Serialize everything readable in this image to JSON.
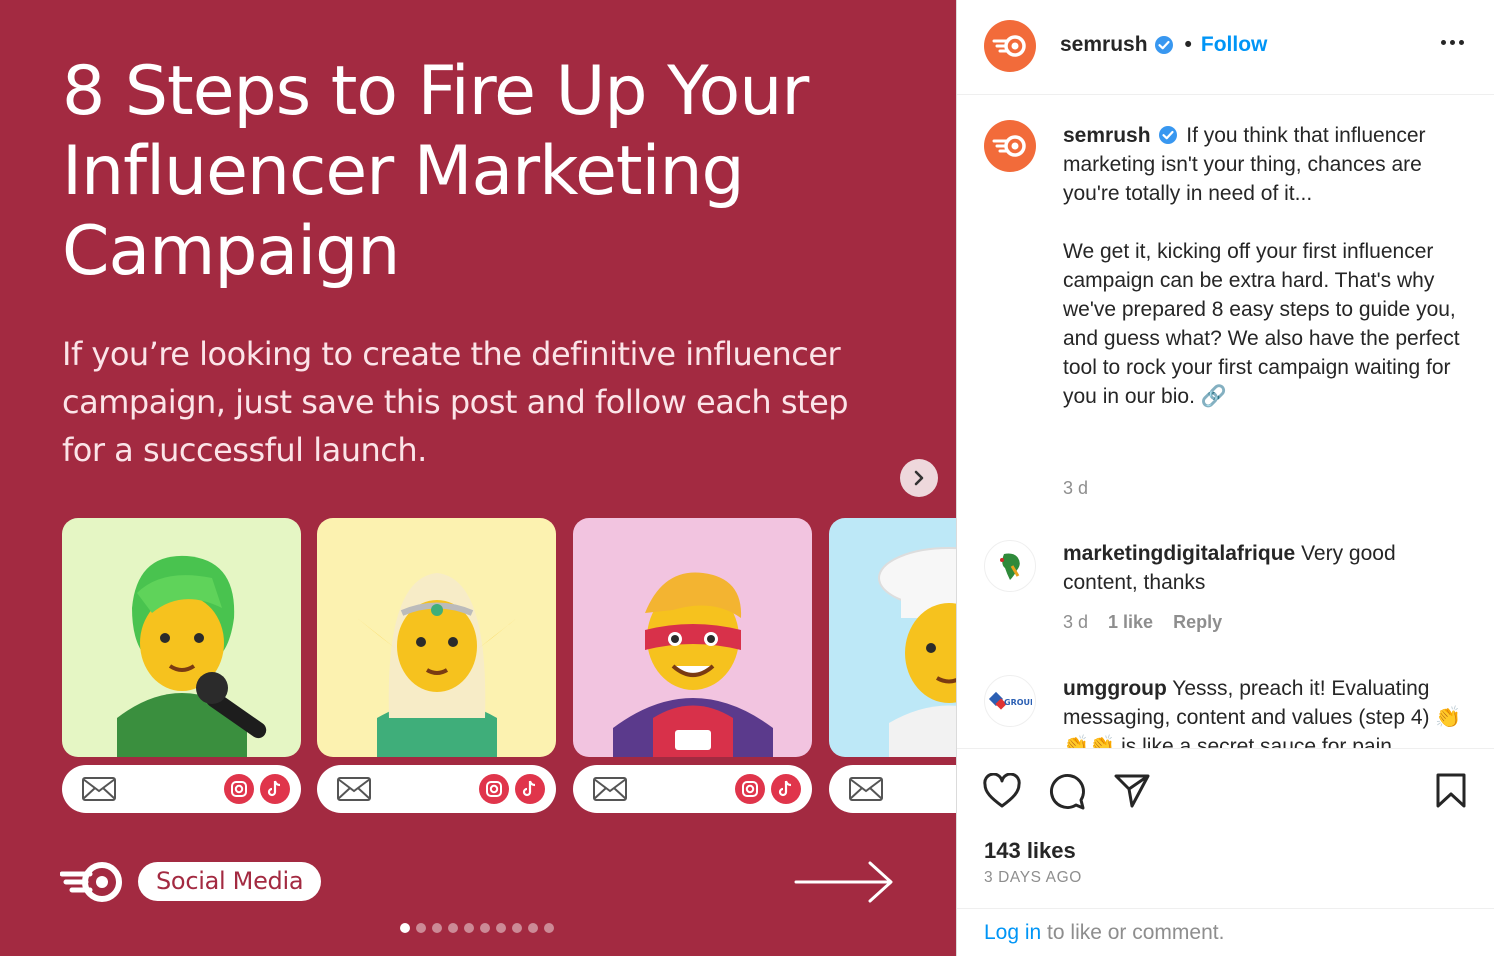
{
  "colors": {
    "post_bg": "#a32a41",
    "brand_orange": "#f26b3a",
    "link_blue": "#0095f6",
    "verified_blue": "#3897f0",
    "social_red": "#e0354b"
  },
  "post": {
    "title": "8 Steps to Fire Up Your Influencer Marketing Campaign",
    "subtitle": "If you’re looking to create the definitive influencer campaign, just save this post and follow each step for a successful launch.",
    "tag": "Social Media",
    "carousel_total": 10,
    "carousel_index": 1,
    "cards": [
      {
        "name": "singer",
        "bg": "#e5f6c4",
        "icons": [
          "mail-icon",
          "instagram-icon",
          "tiktok-icon"
        ]
      },
      {
        "name": "elf",
        "bg": "#fcf2b0",
        "icons": [
          "mail-icon",
          "instagram-icon",
          "tiktok-icon"
        ]
      },
      {
        "name": "superhero",
        "bg": "#f2c4e0",
        "icons": [
          "mail-icon",
          "instagram-icon",
          "tiktok-icon"
        ]
      },
      {
        "name": "cook",
        "bg": "#bde8f7",
        "icons": [
          "mail-icon"
        ]
      }
    ]
  },
  "header": {
    "username": "semrush",
    "separator": "•",
    "follow_label": "Follow"
  },
  "caption": {
    "username": "semrush",
    "text_p1": "If you think that influencer marketing isn't your thing, chances are you're totally in need of it...",
    "text_p2": "We get it, kicking off your first influencer campaign can be extra hard. That's why we've prepared 8 easy steps to guide you, and guess what? We also have the perfect tool to rock your first campaign waiting for you in our bio. 🔗",
    "time": "3 d"
  },
  "comments": [
    {
      "username": "marketingdigitalafrique",
      "text": "Very good content, thanks",
      "time": "3 d",
      "likes": "1 like",
      "reply": "Reply"
    },
    {
      "username": "umggroup",
      "text": "Yesss, preach it! Evaluating messaging, content and values (step 4) 👏👏👏 is like a secret sauce for pain"
    }
  ],
  "footer": {
    "likes": "143 likes",
    "date": "3 DAYS AGO",
    "login_link": "Log in",
    "login_rest": " to like or comment."
  }
}
